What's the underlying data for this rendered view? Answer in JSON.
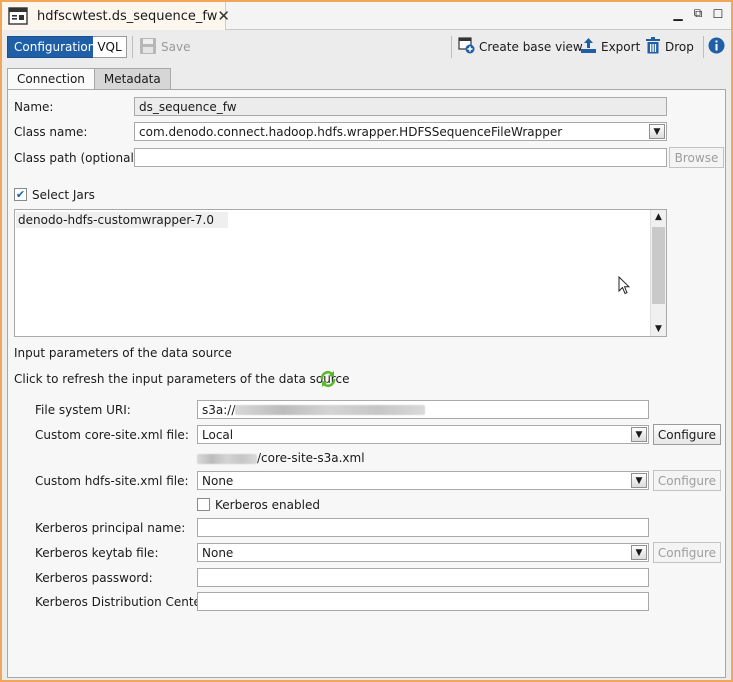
{
  "window": {
    "tab_title": "hdfscwtest.ds_sequence_fw",
    "tab_close": "✕",
    "controls": {
      "minimize": "▁",
      "restore": "⧉",
      "maximize": "☐"
    }
  },
  "toolbar": {
    "configuration_label": "Configuration",
    "vql_label": "VQL",
    "save_label": "Save",
    "create_base_view_label": "Create base view",
    "export_label": "Export",
    "drop_label": "Drop",
    "info_icon": "info-icon"
  },
  "tabs": [
    "Connection",
    "Metadata"
  ],
  "form": {
    "name_label": "Name:",
    "name_value": "ds_sequence_fw",
    "class_name_label": "Class name:",
    "class_name_value": "com.denodo.connect.hadoop.hdfs.wrapper.HDFSSequenceFileWrapper",
    "class_path_label": "Class path (optional):",
    "class_path_value": "",
    "browse_label": "Browse",
    "select_jars_label": "Select Jars",
    "select_jars_checked": true,
    "jars": [
      "denodo-hdfs-customwrapper-7.0"
    ],
    "input_params_heading": "Input parameters of the data source",
    "refresh_text": "Click to refresh the input parameters of the data source"
  },
  "params": {
    "file_system_uri_label": "File system URI:",
    "file_system_uri_prefix": "s3a://",
    "core_site_label": "Custom core-site.xml file:",
    "core_site_value": "Local",
    "core_site_path_suffix": "/core-site-s3a.xml",
    "configure_label": "Configure",
    "hdfs_site_label": "Custom hdfs-site.xml file:",
    "hdfs_site_value": "None",
    "kerberos_enabled_label": "Kerberos enabled",
    "kerberos_enabled_checked": false,
    "kerberos_principal_label": "Kerberos principal name:",
    "kerberos_keytab_label": "Kerberos keytab file:",
    "kerberos_keytab_value": "None",
    "kerberos_password_label": "Kerberos password:",
    "kerberos_kdc_label": "Kerberos Distribution Center:"
  },
  "colors": {
    "accent": "#1f5fa8",
    "frame_border": "#f2a65a",
    "refresh_icon": "#5cb82e"
  }
}
